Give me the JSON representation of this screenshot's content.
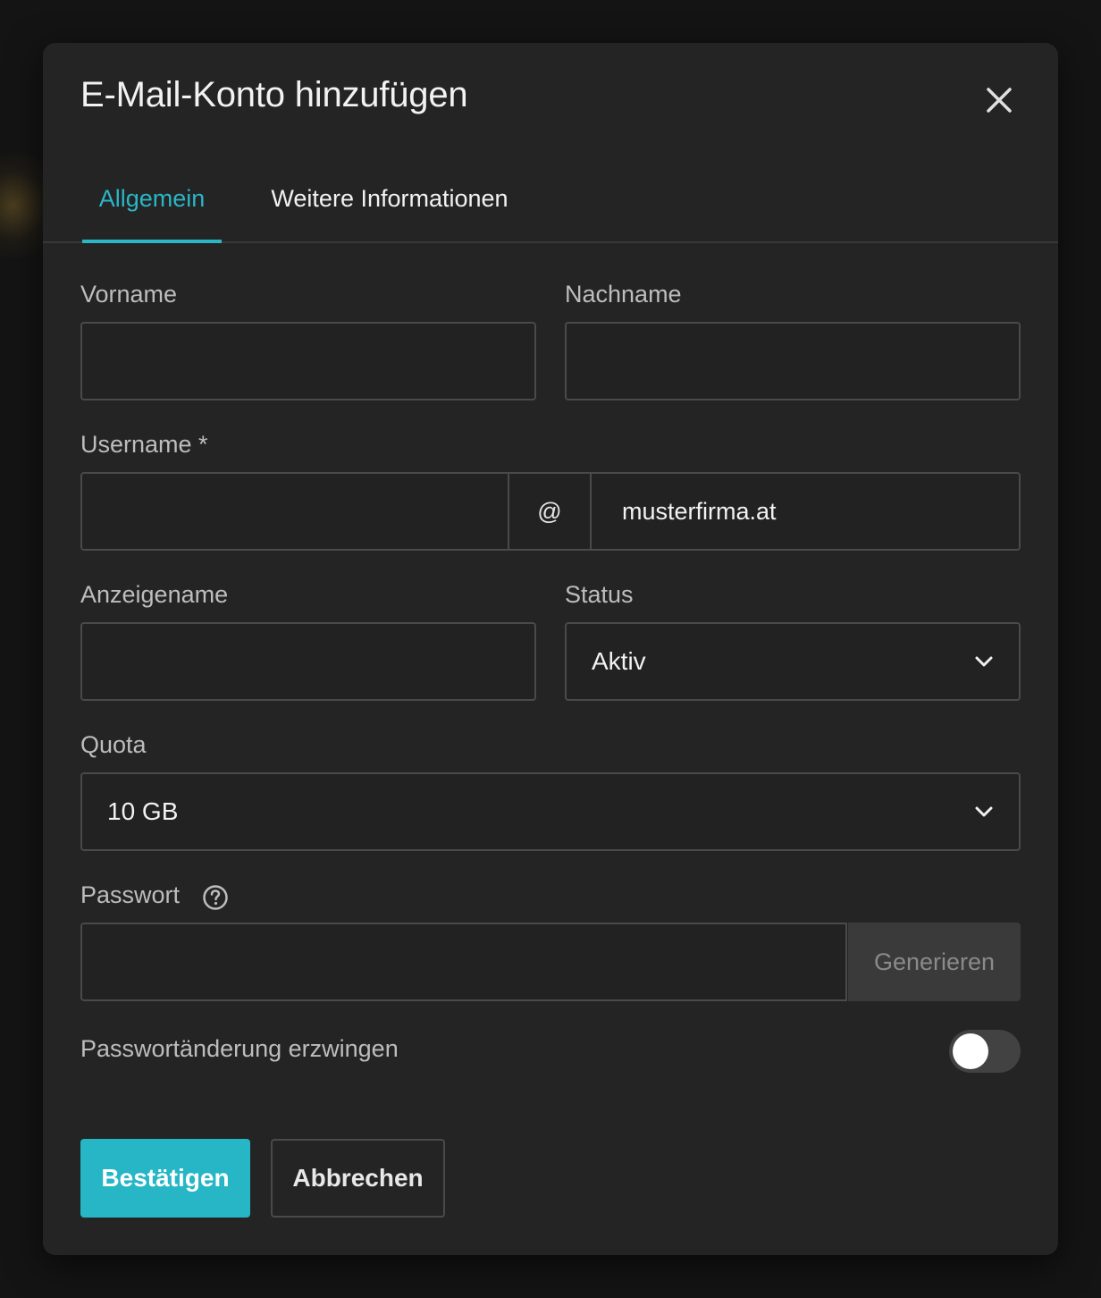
{
  "dialog": {
    "title": "E-Mail-Konto hinzufügen"
  },
  "tabs": [
    {
      "label": "Allgemein",
      "active": true
    },
    {
      "label": "Weitere Informationen",
      "active": false
    }
  ],
  "form": {
    "vorname": {
      "label": "Vorname",
      "value": ""
    },
    "nachname": {
      "label": "Nachname",
      "value": ""
    },
    "username": {
      "label": "Username *",
      "value": "",
      "at_symbol": "@",
      "domain": "musterfirma.at"
    },
    "anzeigename": {
      "label": "Anzeigename",
      "value": ""
    },
    "status": {
      "label": "Status",
      "selected": "Aktiv"
    },
    "quota": {
      "label": "Quota",
      "selected": "10 GB"
    },
    "passwort": {
      "label": "Passwort",
      "value": "",
      "generate_label": "Generieren"
    },
    "force_change": {
      "label": "Passwortänderung erzwingen",
      "enabled": false
    }
  },
  "actions": {
    "confirm_label": "Bestätigen",
    "cancel_label": "Abbrechen"
  },
  "colors": {
    "accent": "#26b6c6",
    "dialog_bg": "#242424",
    "backdrop": "#141414"
  },
  "icons": {
    "close": "close-icon",
    "help": "help-circle-icon",
    "chevron": "chevron-down-icon"
  }
}
